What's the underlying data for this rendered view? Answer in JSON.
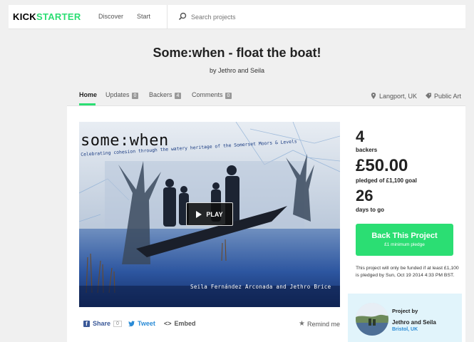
{
  "header": {
    "logo_a": "KICK",
    "logo_b": "STARTER",
    "nav": [
      "Discover",
      "Start"
    ],
    "search_placeholder": "Search projects"
  },
  "project": {
    "title": "Some:when - float the boat!",
    "byline": "by Jethro and Seila"
  },
  "tabs": {
    "home": "Home",
    "updates": "Updates",
    "updates_count": "0",
    "backers": "Backers",
    "backers_count": "4",
    "comments": "Comments",
    "comments_count": "0",
    "location": "Langport, UK",
    "category": "Public Art"
  },
  "video": {
    "title": "some:when",
    "subtitle": "Celebrating cohesion through the watery heritage of the Somerset Moors & Levels",
    "credit": "Seila Fernández Arconada and Jethro Brice",
    "play_label": "PLAY"
  },
  "share": {
    "share_label": "Share",
    "share_count": "0",
    "tweet_label": "Tweet",
    "embed_label": "Embed",
    "remind_label": "Remind me"
  },
  "stats": {
    "backers_value": "4",
    "backers_label": "backers",
    "pledged_value": "£50.00",
    "pledged_label": "pledged of £1,100 goal",
    "days_value": "26",
    "days_label": "days to go"
  },
  "cta": {
    "label": "Back This Project",
    "sub": "£1 minimum pledge"
  },
  "funding_note": "This project will only be funded if at least £1,100 is pledged by Sun, Oct 19 2014 4:33 PM BST.",
  "creator": {
    "label": "Project by",
    "name": "Jethro and Seila",
    "location": "Bristol, UK"
  },
  "colors": {
    "accent_green": "#2bde73",
    "link_blue": "#2a8bd6",
    "creator_bg": "#e1f4fb"
  }
}
